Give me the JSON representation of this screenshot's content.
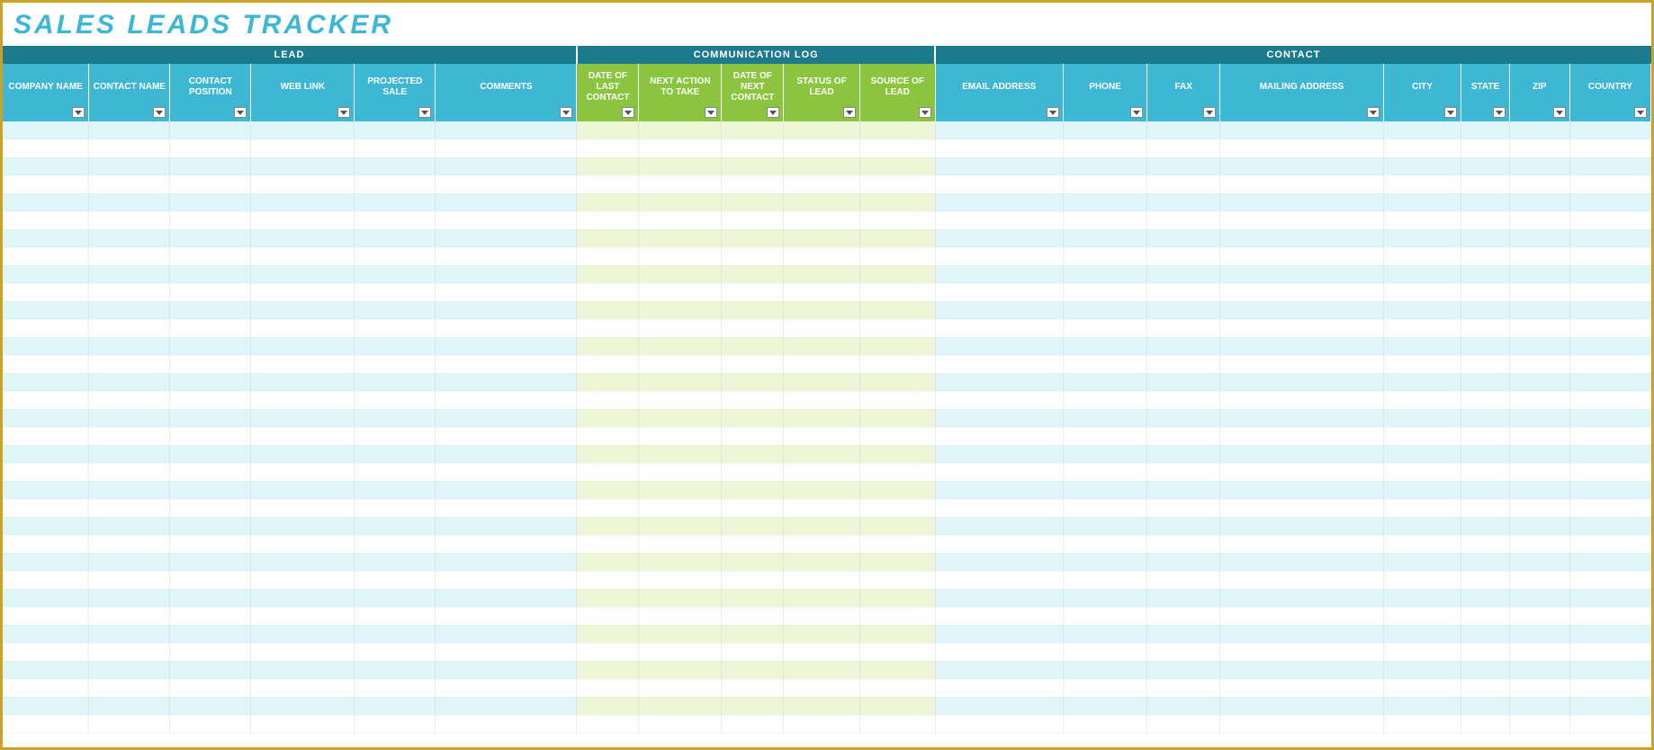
{
  "title": "SALES LEADS TRACKER",
  "groups": [
    {
      "label": "LEAD",
      "span": 6
    },
    {
      "label": "COMMUNICATION LOG",
      "span": 5
    },
    {
      "label": "CONTACT",
      "span": 8
    }
  ],
  "columns": [
    {
      "label": "COMPANY NAME",
      "group": "lead",
      "cls": "c-company"
    },
    {
      "label": "CONTACT NAME",
      "group": "lead",
      "cls": "c-cname"
    },
    {
      "label": "CONTACT POSITION",
      "group": "lead",
      "cls": "c-cpos"
    },
    {
      "label": "WEB LINK",
      "group": "lead",
      "cls": "c-web"
    },
    {
      "label": "PROJECTED SALE",
      "group": "lead",
      "cls": "c-proj"
    },
    {
      "label": "COMMENTS",
      "group": "lead",
      "cls": "c-comm"
    },
    {
      "label": "DATE OF LAST CONTACT",
      "group": "comm",
      "cls": "c-dlc"
    },
    {
      "label": "NEXT ACTION TO TAKE",
      "group": "comm",
      "cls": "c-nat"
    },
    {
      "label": "DATE OF NEXT CONTACT",
      "group": "comm",
      "cls": "c-dnc"
    },
    {
      "label": "STATUS OF LEAD",
      "group": "comm",
      "cls": "c-sol"
    },
    {
      "label": "SOURCE OF LEAD",
      "group": "comm",
      "cls": "c-srl"
    },
    {
      "label": "EMAIL ADDRESS",
      "group": "contact",
      "cls": "c-email"
    },
    {
      "label": "PHONE",
      "group": "contact",
      "cls": "c-phone"
    },
    {
      "label": "FAX",
      "group": "contact",
      "cls": "c-fax"
    },
    {
      "label": "MAILING ADDRESS",
      "group": "contact",
      "cls": "c-mail"
    },
    {
      "label": "CITY",
      "group": "contact",
      "cls": "c-city"
    },
    {
      "label": "STATE",
      "group": "contact",
      "cls": "c-state"
    },
    {
      "label": "ZIP",
      "group": "contact",
      "cls": "c-zip"
    },
    {
      "label": "COUNTRY",
      "group": "contact",
      "cls": "c-country"
    }
  ],
  "rowCount": 34,
  "colors": {
    "titleColor": "#3db7d4",
    "borderColor": "#c9a227",
    "groupHeaderBg": "#1b7a8c",
    "leadColBg": "#3db7d4",
    "commColBg": "#8bc540",
    "contactColBg": "#3db7d4",
    "leadRowAlt": "#e0f5f9",
    "commRowAlt": "#eef6d8"
  }
}
